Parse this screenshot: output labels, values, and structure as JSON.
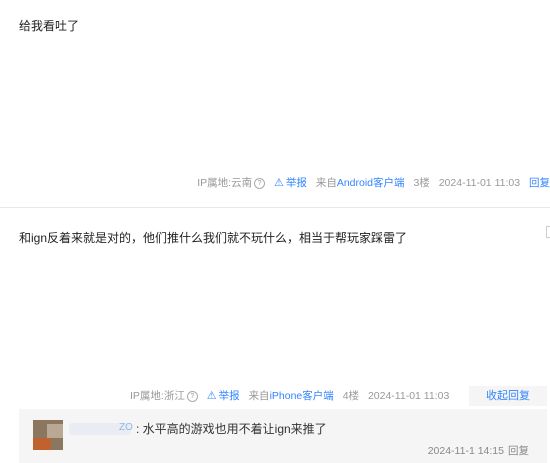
{
  "posts": [
    {
      "content": "给我看吐了",
      "ip": "IP属地:云南",
      "report": "举报",
      "source_prefix": "来自",
      "source": "Android客户端",
      "floor": "3楼",
      "time": "2024-11-01 11:03",
      "action": "回复"
    },
    {
      "content": "和ign反着来就是对的，他们推什么我们就不玩什么，相当于帮玩家踩雷了",
      "ip": "IP属地:浙江",
      "report": "举报",
      "source_prefix": "来自",
      "source": "iPhone客户端",
      "floor": "4楼",
      "time": "2024-11-01 11:03",
      "action": "收起回复"
    }
  ],
  "sub_reply": {
    "name_tail": "ZO",
    "text": ": 水平高的游戏也用不着让ign来推了",
    "time": "2024-11-1 14:15",
    "action": "回复"
  },
  "icons": {
    "help": "question-circle-icon",
    "warning": "warning-triangle-icon"
  },
  "colors": {
    "link": "#3385ff",
    "meta": "#999999",
    "reply_bg": "#f5f5f5"
  }
}
